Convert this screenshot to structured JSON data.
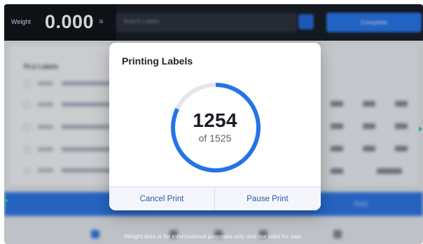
{
  "header": {
    "weight_label": "Weight",
    "weight_value": "0.000",
    "weight_unit": "lb",
    "search_placeholder": "Search Labels",
    "complete_label": "Complete"
  },
  "background": {
    "list_title": "PLU Labels",
    "print_bar_label": "Print"
  },
  "disclaimer": "Weight data is for informational purposes only and not valid for sale.",
  "modal": {
    "title": "Printing Labels",
    "printed_count": "1254",
    "total_label": "of 1525",
    "progress_fraction": 0.822,
    "cancel_label": "Cancel Print",
    "pause_label": "Pause Print"
  },
  "colors": {
    "accent": "#2474e8",
    "ring_track": "#e3e6ea",
    "topbar": "#171a21"
  }
}
